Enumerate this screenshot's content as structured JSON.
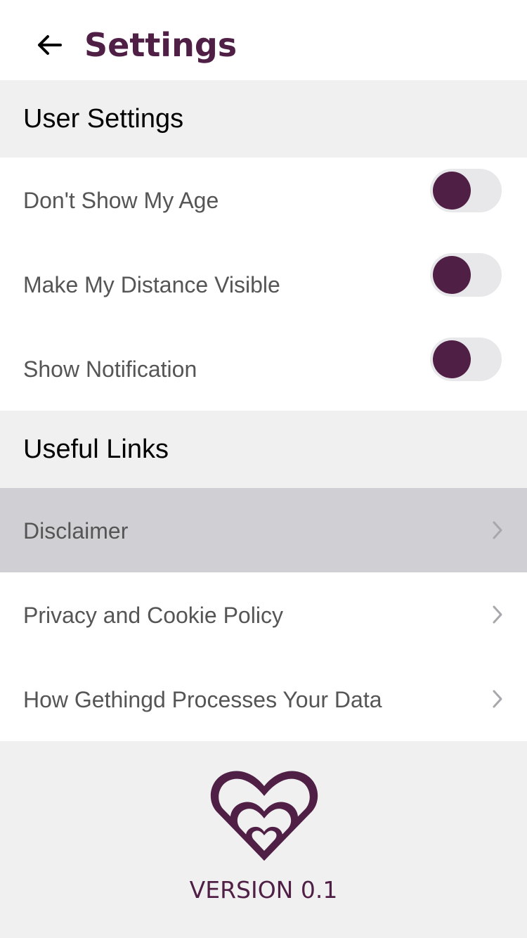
{
  "header": {
    "title": "Settings",
    "back_icon": "arrow-left-icon"
  },
  "user_settings": {
    "title": "User Settings",
    "items": [
      {
        "label": "Don't Show My Age",
        "toggle_on": false
      },
      {
        "label": "Make My Distance Visible",
        "toggle_on": false
      },
      {
        "label": "Show Notification",
        "toggle_on": false
      }
    ]
  },
  "useful_links": {
    "title": "Useful Links",
    "items": [
      {
        "label": "Disclaimer",
        "highlighted": true
      },
      {
        "label": "Privacy and Cookie Policy",
        "highlighted": false
      },
      {
        "label": "How Gethingd Processes Your Data",
        "highlighted": false
      }
    ]
  },
  "footer": {
    "logo_icon": "heart-logo-icon",
    "version": "VERSION 0.1"
  },
  "colors": {
    "brand": "#4f1f45",
    "section_bg": "#f0f0f0",
    "highlight_row": "#d0d0d4",
    "toggle_track": "#e8e8ea"
  }
}
